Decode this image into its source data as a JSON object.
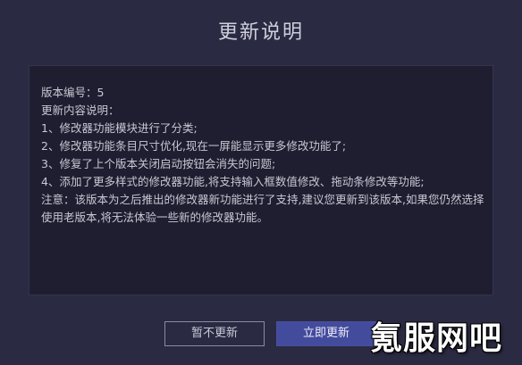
{
  "dialog": {
    "title": "更新说明",
    "lines": [
      "版本编号：5",
      "更新内容说明：",
      "1、修改器功能模块进行了分类;",
      "2、修改器功能条目尺寸优化,现在一屏能显示更多修改功能了;",
      "3、修复了上个版本关闭启动按钮会消失的问题;",
      "4、添加了更多样式的修改器功能,将支持输入框数值修改、拖动条修改等功能;"
    ],
    "note": "注意：该版本为之后推出的修改器新功能进行了支持,建议您更新到该版本,如果您仍然选择使用老版本,将无法体验一些新的修改器功能。",
    "buttons": {
      "later_label": "暂不更新",
      "update_label": "立即更新"
    }
  },
  "watermark": "氪服网吧",
  "colors": {
    "background": "#2b2a43",
    "content_background": "#1f1e30",
    "primary_button": "#434b9d"
  }
}
